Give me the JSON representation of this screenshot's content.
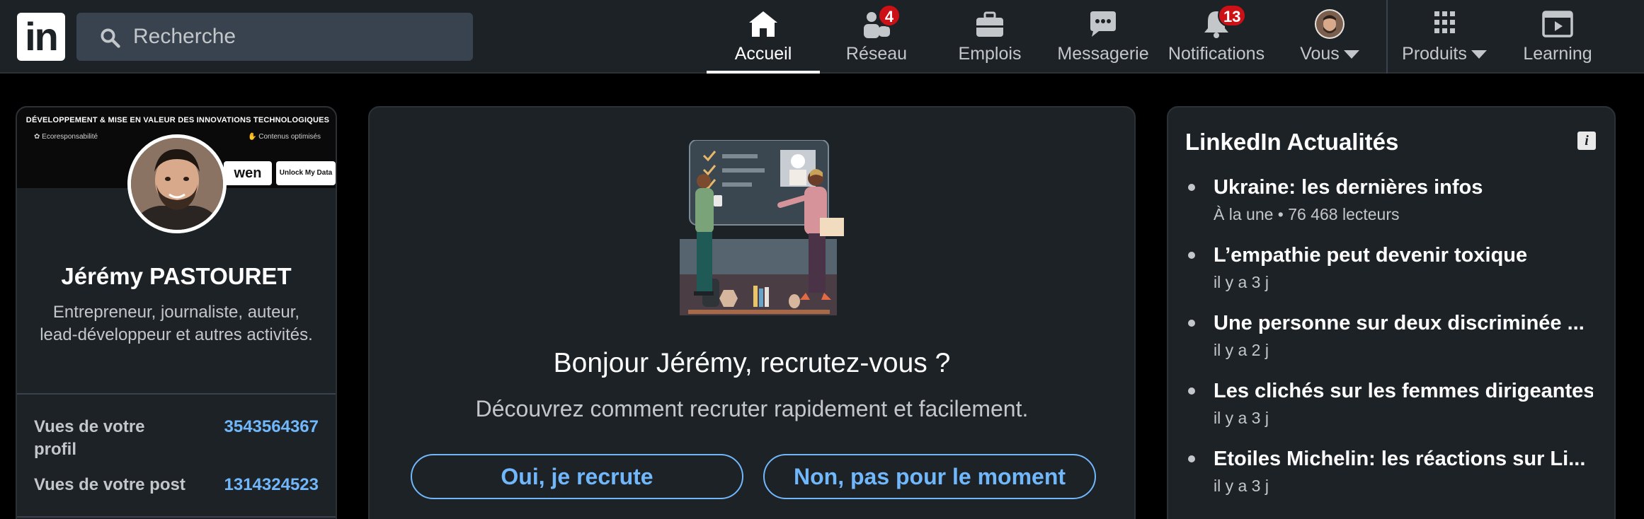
{
  "nav": {
    "logo_text": "in",
    "search_placeholder": "Recherche",
    "items": [
      {
        "label": "Accueil",
        "icon": "home-icon",
        "active": true
      },
      {
        "label": "Réseau",
        "icon": "network-icon",
        "badge": "4"
      },
      {
        "label": "Emplois",
        "icon": "briefcase-icon"
      },
      {
        "label": "Messagerie",
        "icon": "message-icon"
      },
      {
        "label": "Notifications",
        "icon": "bell-icon",
        "badge": "13"
      },
      {
        "label": "Vous",
        "icon": "avatar"
      },
      {
        "label": "Produits",
        "icon": "grid-icon"
      },
      {
        "label": "Learning",
        "icon": "learning-icon"
      }
    ]
  },
  "profile": {
    "banner_title": "DÉVELOPPEMENT & MISE EN VALEUR DES INNOVATIONS TECHNOLOGIQUES",
    "banner_tags": [
      "Ecoresponsabilité",
      "Contenus optimisés"
    ],
    "banner_chips": [
      "wen",
      "Unlock My Data"
    ],
    "name": "Jérémy PASTOURET",
    "headline": "Entrepreneur, journaliste, auteur, lead-développeur et autres activités.",
    "stats": [
      {
        "label": "Vues de votre profil",
        "value": "3543564367"
      },
      {
        "label": "Vues de votre post",
        "value": "1314324523"
      }
    ]
  },
  "hire": {
    "title": "Bonjour Jérémy, recrutez-vous ?",
    "subtitle": "Découvrez comment recruter rapidement et facilement.",
    "yes_label": "Oui, je recrute",
    "no_label": "Non, pas pour le moment"
  },
  "news": {
    "title": "LinkedIn Actualités",
    "info_icon": "i",
    "items": [
      {
        "headline": "Ukraine: les dernières infos",
        "meta": "À la une • 76 468 lecteurs"
      },
      {
        "headline": "L’empathie peut devenir toxique",
        "meta": "il y a 3 j"
      },
      {
        "headline": "Une personne sur deux discriminée ...",
        "meta": "il y a 2 j"
      },
      {
        "headline": "Les clichés sur les femmes dirigeantes",
        "meta": "il y a 3 j"
      },
      {
        "headline": "Etoiles Michelin: les réactions sur Li...",
        "meta": "il y a 3 j"
      }
    ]
  },
  "colors": {
    "background": "#000000",
    "card": "#1d2226",
    "link": "#71b7fb",
    "badge": "#cc1016"
  }
}
